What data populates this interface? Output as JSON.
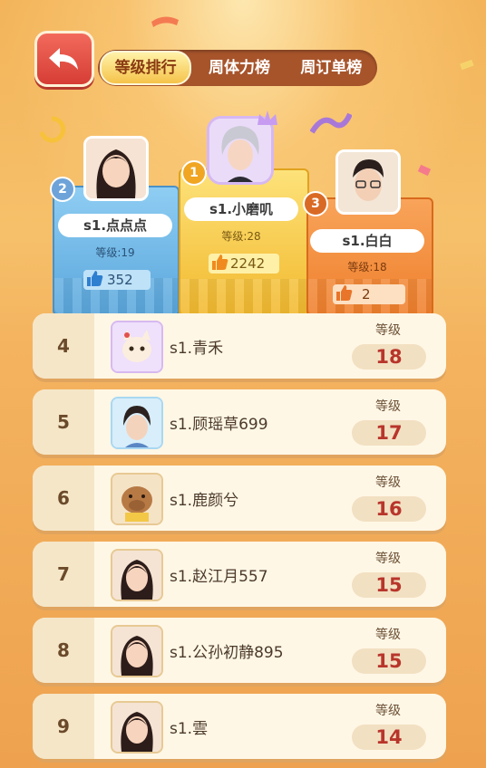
{
  "tabs": [
    "等级排行",
    "周体力榜",
    "周订单榜"
  ],
  "active_tab": 0,
  "colors": {
    "accent_red": "#b8352b",
    "tab_bar": "#a7542b",
    "podium_blue": "#6bb6e6",
    "podium_gold": "#f4c534",
    "podium_orange": "#f3893b"
  },
  "level_label": "等级",
  "podium": {
    "first": {
      "rank": "1",
      "name": "s1.小磨叽",
      "level_text": "等级:28",
      "likes": "2242"
    },
    "second": {
      "rank": "2",
      "name": "s1.点点点",
      "level_text": "等级:19",
      "likes": "352"
    },
    "third": {
      "rank": "3",
      "name": "s1.白白",
      "level_text": "等级:18",
      "likes": "2"
    }
  },
  "rows": [
    {
      "rank": "4",
      "name": "s1.青禾",
      "level": "18",
      "avatar": "cat-avatar"
    },
    {
      "rank": "5",
      "name": "s1.顾瑶草699",
      "level": "17",
      "avatar": "boy-avatar"
    },
    {
      "rank": "6",
      "name": "s1.鹿颜兮",
      "level": "16",
      "avatar": "capybara-avatar"
    },
    {
      "rank": "7",
      "name": "s1.赵江月557",
      "level": "15",
      "avatar": "girl-avatar"
    },
    {
      "rank": "8",
      "name": "s1.公孙初静895",
      "level": "15",
      "avatar": "girl-avatar"
    },
    {
      "rank": "9",
      "name": "s1.雲",
      "level": "14",
      "avatar": "girl-avatar"
    }
  ]
}
